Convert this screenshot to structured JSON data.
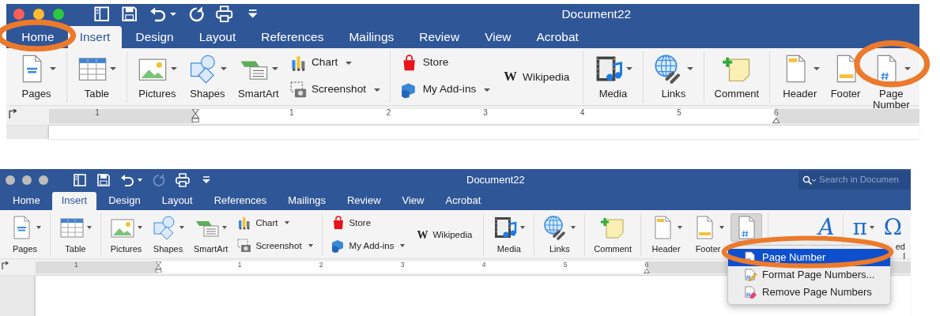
{
  "screenshots": [
    {
      "window": {
        "title": "Document22",
        "focused": true
      },
      "quick_access": [
        {
          "disabled": false
        },
        {
          "disabled": false
        },
        {
          "disabled": false
        },
        {
          "disabled": false
        },
        {
          "disabled": false
        },
        {
          "disabled": false
        }
      ],
      "tabs": [
        {
          "label": "Home",
          "selected": false,
          "circled": true
        },
        {
          "label": "Insert",
          "selected": true,
          "circled": false
        },
        {
          "label": "Design",
          "selected": false,
          "circled": false
        },
        {
          "label": "Layout",
          "selected": false,
          "circled": false
        },
        {
          "label": "References",
          "selected": false,
          "circled": false
        },
        {
          "label": "Mailings",
          "selected": false,
          "circled": false
        },
        {
          "label": "Review",
          "selected": false,
          "circled": false
        },
        {
          "label": "View",
          "selected": false,
          "circled": false
        },
        {
          "label": "Acrobat",
          "selected": false,
          "circled": false
        }
      ],
      "ribbon_groups": [
        [
          {
            "kind": "large",
            "label": "Pages",
            "dropdown": true,
            "pressed": false,
            "circled": false
          }
        ],
        [
          {
            "kind": "large",
            "label": "Table",
            "dropdown": true,
            "pressed": false,
            "circled": false
          }
        ],
        [
          {
            "kind": "large",
            "label": "Pictures",
            "dropdown": true,
            "pressed": false,
            "circled": false
          },
          {
            "kind": "large",
            "label": "Shapes",
            "dropdown": true,
            "pressed": false,
            "circled": false
          },
          {
            "kind": "large",
            "label": "SmartArt",
            "dropdown": true,
            "pressed": false,
            "circled": false
          },
          {
            "kind": "small",
            "label": "Chart",
            "dropdown": true,
            "pressed": false,
            "circled": false
          },
          {
            "kind": "small",
            "label": "Screenshot",
            "dropdown": true,
            "pressed": false,
            "circled": false
          }
        ],
        [
          {
            "kind": "small",
            "label": "Store",
            "dropdown": false,
            "pressed": false,
            "circled": false
          },
          {
            "kind": "small",
            "label": "My Add-ins",
            "dropdown": true,
            "pressed": false,
            "circled": false
          },
          {
            "kind": "inline",
            "glyph": "W",
            "label": "Wikipedia",
            "dropdown": false,
            "pressed": false,
            "circled": false
          }
        ],
        [
          {
            "kind": "large",
            "label": "Media",
            "dropdown": true,
            "pressed": false,
            "circled": false
          }
        ],
        [
          {
            "kind": "large",
            "label": "Links",
            "dropdown": true,
            "pressed": false,
            "circled": false
          }
        ],
        [
          {
            "kind": "large",
            "label": "Comment",
            "dropdown": false,
            "pressed": false,
            "circled": false
          }
        ],
        [
          {
            "kind": "large",
            "label": "Header",
            "dropdown": true,
            "pressed": false,
            "circled": false
          },
          {
            "kind": "large",
            "label": "Footer",
            "dropdown": false,
            "pressed": false,
            "circled": false
          },
          {
            "kind": "large",
            "label": "Page Number",
            "dropdown": true,
            "pressed": false,
            "circled": true
          }
        ]
      ],
      "ruler": [
        "1",
        "1",
        "2",
        "3",
        "4",
        "5",
        "6"
      ]
    },
    {
      "window": {
        "title": "Document22",
        "focused": false
      },
      "search": {
        "placeholder": "Search in Documen"
      },
      "quick_access": [
        {
          "disabled": false
        },
        {
          "disabled": false
        },
        {
          "disabled": false
        },
        {
          "disabled": true
        },
        {
          "disabled": false
        },
        {
          "disabled": false
        }
      ],
      "tabs": [
        {
          "label": "Home",
          "selected": false,
          "circled": false
        },
        {
          "label": "Insert",
          "selected": true,
          "circled": false
        },
        {
          "label": "Design",
          "selected": false,
          "circled": false
        },
        {
          "label": "Layout",
          "selected": false,
          "circled": false
        },
        {
          "label": "References",
          "selected": false,
          "circled": false
        },
        {
          "label": "Mailings",
          "selected": false,
          "circled": false
        },
        {
          "label": "Review",
          "selected": false,
          "circled": false
        },
        {
          "label": "View",
          "selected": false,
          "circled": false
        },
        {
          "label": "Acrobat",
          "selected": false,
          "circled": false
        }
      ],
      "ribbon_groups": [
        [
          {
            "kind": "large",
            "label": "Pages",
            "dropdown": true,
            "pressed": false,
            "circled": false
          }
        ],
        [
          {
            "kind": "large",
            "label": "Table",
            "dropdown": true,
            "pressed": false,
            "circled": false
          }
        ],
        [
          {
            "kind": "large",
            "label": "Pictures",
            "dropdown": true,
            "pressed": false,
            "circled": false
          },
          {
            "kind": "large",
            "label": "Shapes",
            "dropdown": true,
            "pressed": false,
            "circled": false
          },
          {
            "kind": "large",
            "label": "SmartArt",
            "dropdown": true,
            "pressed": false,
            "circled": false
          },
          {
            "kind": "small",
            "label": "Chart",
            "dropdown": true,
            "pressed": false,
            "circled": false
          },
          {
            "kind": "small",
            "label": "Screenshot",
            "dropdown": true,
            "pressed": false,
            "circled": false
          }
        ],
        [
          {
            "kind": "small",
            "label": "Store",
            "dropdown": false,
            "pressed": false,
            "circled": false
          },
          {
            "kind": "small",
            "label": "My Add-ins",
            "dropdown": true,
            "pressed": false,
            "circled": false
          },
          {
            "kind": "inline",
            "glyph": "W",
            "label": "Wikipedia",
            "dropdown": false,
            "pressed": false,
            "circled": false
          }
        ],
        [
          {
            "kind": "large",
            "label": "Media",
            "dropdown": true,
            "pressed": false,
            "circled": false
          }
        ],
        [
          {
            "kind": "large",
            "label": "Links",
            "dropdown": true,
            "pressed": false,
            "circled": false
          }
        ],
        [
          {
            "kind": "large",
            "label": "Comment",
            "dropdown": false,
            "pressed": false,
            "circled": false
          }
        ],
        [
          {
            "kind": "large",
            "label": "Header",
            "dropdown": true,
            "pressed": false,
            "circled": false
          },
          {
            "kind": "large",
            "label": "Footer",
            "dropdown": true,
            "pressed": false,
            "circled": false
          },
          {
            "kind": "large",
            "dropdown": false,
            "pressed": true,
            "circled": false,
            "menu": [
              {
                "label": "Page Number",
                "selected": true,
                "circled": true
              },
              {
                "label": "Format Page Numbers...",
                "selected": false,
                "circled": false
              },
              {
                "label": "Remove Page Numbers",
                "selected": false,
                "circled": false
              }
            ]
          }
        ],
        [
          {
            "kind": "glyph",
            "glyph": "A",
            "dropdown": false,
            "pressed": false,
            "circled": false
          }
        ],
        [
          {
            "kind": "glyph",
            "glyph": "π",
            "dropdown": true,
            "pressed": false,
            "circled": false
          },
          {
            "kind": "glyph",
            "glyph": "Ω",
            "label_lines": [
              "ed",
              "l"
            ],
            "dropdown": false,
            "pressed": false,
            "circled": false
          }
        ]
      ],
      "ruler": [
        "1",
        "1",
        "2",
        "3",
        "4",
        "5",
        "6"
      ]
    }
  ]
}
